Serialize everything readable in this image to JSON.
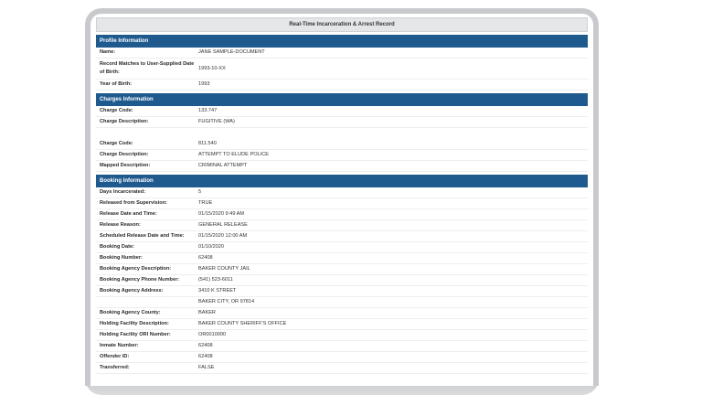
{
  "title": "Real-Time Incarceration & Arrest Record",
  "profile": {
    "header": "Profile Information",
    "rows": [
      {
        "label": "Name:",
        "value": "JANE SAMPLE-DOCUMENT"
      },
      {
        "label": "Record Matches to User-Supplied Date of Birth:",
        "value": "1993-10-XX"
      },
      {
        "label": "Year of Birth:",
        "value": "1993"
      }
    ]
  },
  "charges": {
    "header": "Charges Information",
    "rows1": [
      {
        "label": "Charge Code:",
        "value": "133.747"
      },
      {
        "label": "Charge Description:",
        "value": "FUGITIVE (WA)"
      }
    ],
    "rows2": [
      {
        "label": "Charge Code:",
        "value": "811.540"
      },
      {
        "label": "Charge Description:",
        "value": "ATTEMPT TO ELUDE POLICE"
      },
      {
        "label": "Mapped Description:",
        "value": "CRIMINAL ATTEMPT"
      }
    ]
  },
  "booking": {
    "header": "Booking Information",
    "rows": [
      {
        "label": "Days Incarcerated:",
        "value": "5"
      },
      {
        "label": "Released from Supervision:",
        "value": "TRUE"
      },
      {
        "label": "Release Date and Time:",
        "value": "01/15/2020 9:49 AM"
      },
      {
        "label": "Release Reason:",
        "value": "GENERAL RELEASE"
      },
      {
        "label": "Scheduled Release Date and Time:",
        "value": "01/15/2020 12:00 AM"
      },
      {
        "label": "Booking Date:",
        "value": "01/10/2020"
      },
      {
        "label": "Booking Number:",
        "value": "62408"
      },
      {
        "label": "Booking Agency Description:",
        "value": "BAKER COUNTY JAIL"
      },
      {
        "label": "Booking Agency Phone Number:",
        "value": "(541) 523-6011"
      },
      {
        "label": "Booking Agency Address:",
        "value": "3410 K STREET"
      },
      {
        "label": "",
        "value": "BAKER CITY, OR 97814"
      },
      {
        "label": "Booking Agency County:",
        "value": "BAKER"
      },
      {
        "label": "Holding Facility Description:",
        "value": "BAKER COUNTY SHERIFF'S OFFICE"
      },
      {
        "label": "Holding Facility ORI Number:",
        "value": "OR0010000"
      },
      {
        "label": "Inmate Number:",
        "value": "62408"
      },
      {
        "label": "Offender ID:",
        "value": "62408"
      },
      {
        "label": "Transferred:",
        "value": "FALSE"
      }
    ]
  }
}
